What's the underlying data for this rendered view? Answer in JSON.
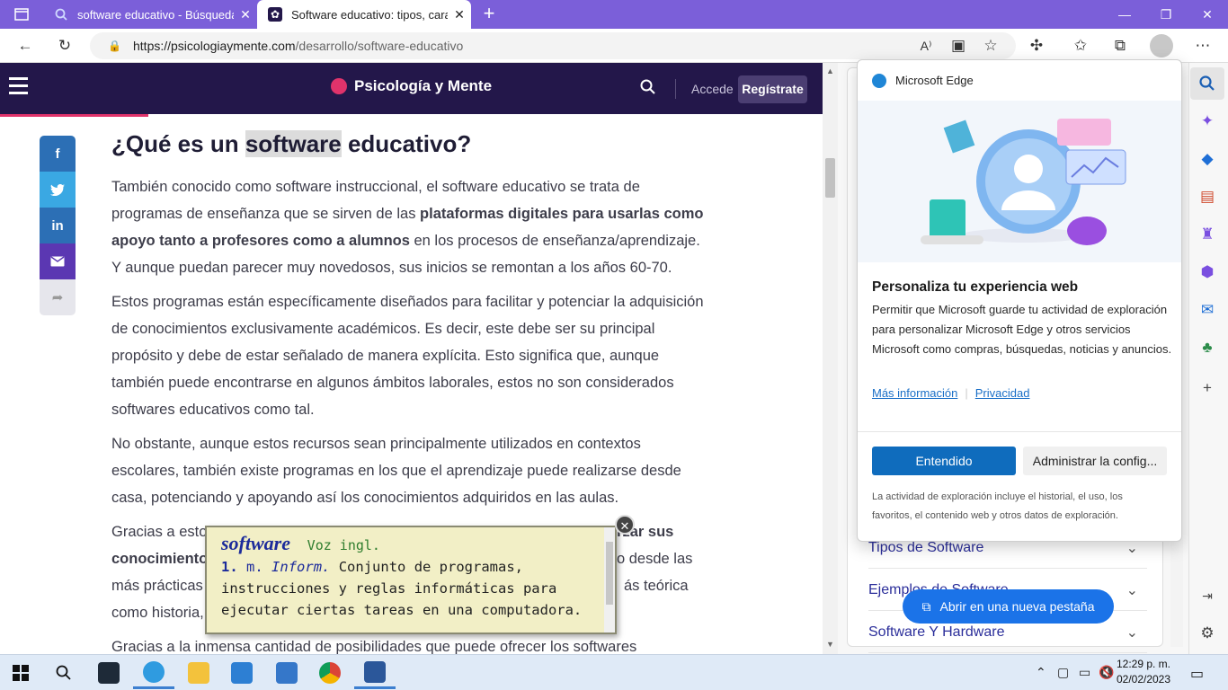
{
  "browser": {
    "tabs": [
      {
        "label": "software educativo - Búsqueda",
        "favicon": "search-icon"
      },
      {
        "label": "Software educativo: tipos, caracte",
        "favicon": "brain-icon"
      }
    ],
    "url_domain": "https://psicologiaymente.com",
    "url_path": "/desarrollo/software-educativo"
  },
  "site": {
    "brand": "Psicología y Mente",
    "login": "Accede",
    "signup": "Regístrate"
  },
  "share": {
    "facebook": "f",
    "twitter": "t",
    "linkedin": "in"
  },
  "article": {
    "h1_before": "¿Qué es un ",
    "h1_highlight": "software",
    "h1_after": " educativo?",
    "p1_a": "También conocido como software instruccional, el software educativo se trata de programas de enseñanza que se sirven de las ",
    "p1_b": "plataformas digitales para usarlas como apoyo tanto a profesores como a alumnos",
    "p1_c": " en los procesos de enseñanza/aprendizaje. Y aunque puedan parecer muy novedosos, sus inicios se remontan a los años 60-70.",
    "p2": "Estos programas están específicamente diseñados para facilitar y potenciar la adquisición de conocimientos exclusivamente académicos. Es decir, este debe ser su principal propósito y debe de estar señalado de manera explícita. Esto significa que, aunque también puede encontrarse en algunos ámbitos laborales, estos no son considerados softwares educativos como tal.",
    "p3": "No obstante, aunque estos recursos sean principalmente utilizados en contextos escolares, también existe programas en los que el aprendizaje puede realizarse desde casa, potenciando y apoyando así los conocimientos adquiridos en las aulas.",
    "p4_a": "Gracias a estos",
    "p4_b": "orzar sus",
    "p4_c": "conocimiento",
    "p4_d": "o desde las",
    "p4_e": "más prácticas",
    "p4_f": "ás teórica",
    "p4_g": "como historia,",
    "p5": "Gracias a la inmensa cantidad de posibilidades que puede ofrecer los softwares"
  },
  "dictionary_popup": {
    "word": "software",
    "origin": "Voz ingl.",
    "sense_num": "1.",
    "grammar": "m.",
    "field": "Inform.",
    "definition": "Conjunto de programas, instrucciones y reglas informáticas para ejecutar ciertas tareas en una computadora."
  },
  "side_panel": {
    "accordion": [
      "Tipos de Software",
      "Ejemplos de Software",
      "Software Y Hardware"
    ],
    "open_new_tab": "Abrir en una nueva pestaña"
  },
  "edge_popup": {
    "app_name": "Microsoft Edge",
    "title": "Personaliza tu experiencia web",
    "body": "Permitir que Microsoft guarde tu actividad de exploración para personalizar Microsoft Edge y otros servicios Microsoft como compras, búsquedas, noticias y anuncios.",
    "link_more": "Más información",
    "link_privacy": "Privacidad",
    "btn_ok": "Entendido",
    "btn_manage": "Administrar la config...",
    "footer": "La actividad de exploración incluye el historial, el uso, los favoritos, el contenido web y otros datos de exploración."
  },
  "taskbar": {
    "time": "12:29 p. m.",
    "date": "02/02/2023"
  },
  "colors": {
    "tabbar": "#7b5fd9",
    "site_header": "#23174a",
    "accent_pink": "#e0336b",
    "edge_blue": "#0f6cbd"
  }
}
